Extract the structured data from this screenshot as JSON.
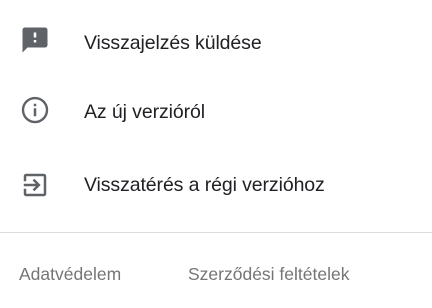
{
  "menu": {
    "items": [
      {
        "icon": "feedback-icon",
        "label": "Visszajelzés küldése"
      },
      {
        "icon": "info-icon",
        "label": "Az új verzióról"
      },
      {
        "icon": "exit-to-app-icon",
        "label": "Visszatérés a régi verzióhoz"
      }
    ]
  },
  "footer": {
    "privacy_label": "Adatvédelem",
    "terms_label": "Szerződési feltételek"
  },
  "colors": {
    "text_primary": "#202124",
    "icon": "#5f6368",
    "footer_text": "#757575",
    "divider": "#dadce0"
  }
}
